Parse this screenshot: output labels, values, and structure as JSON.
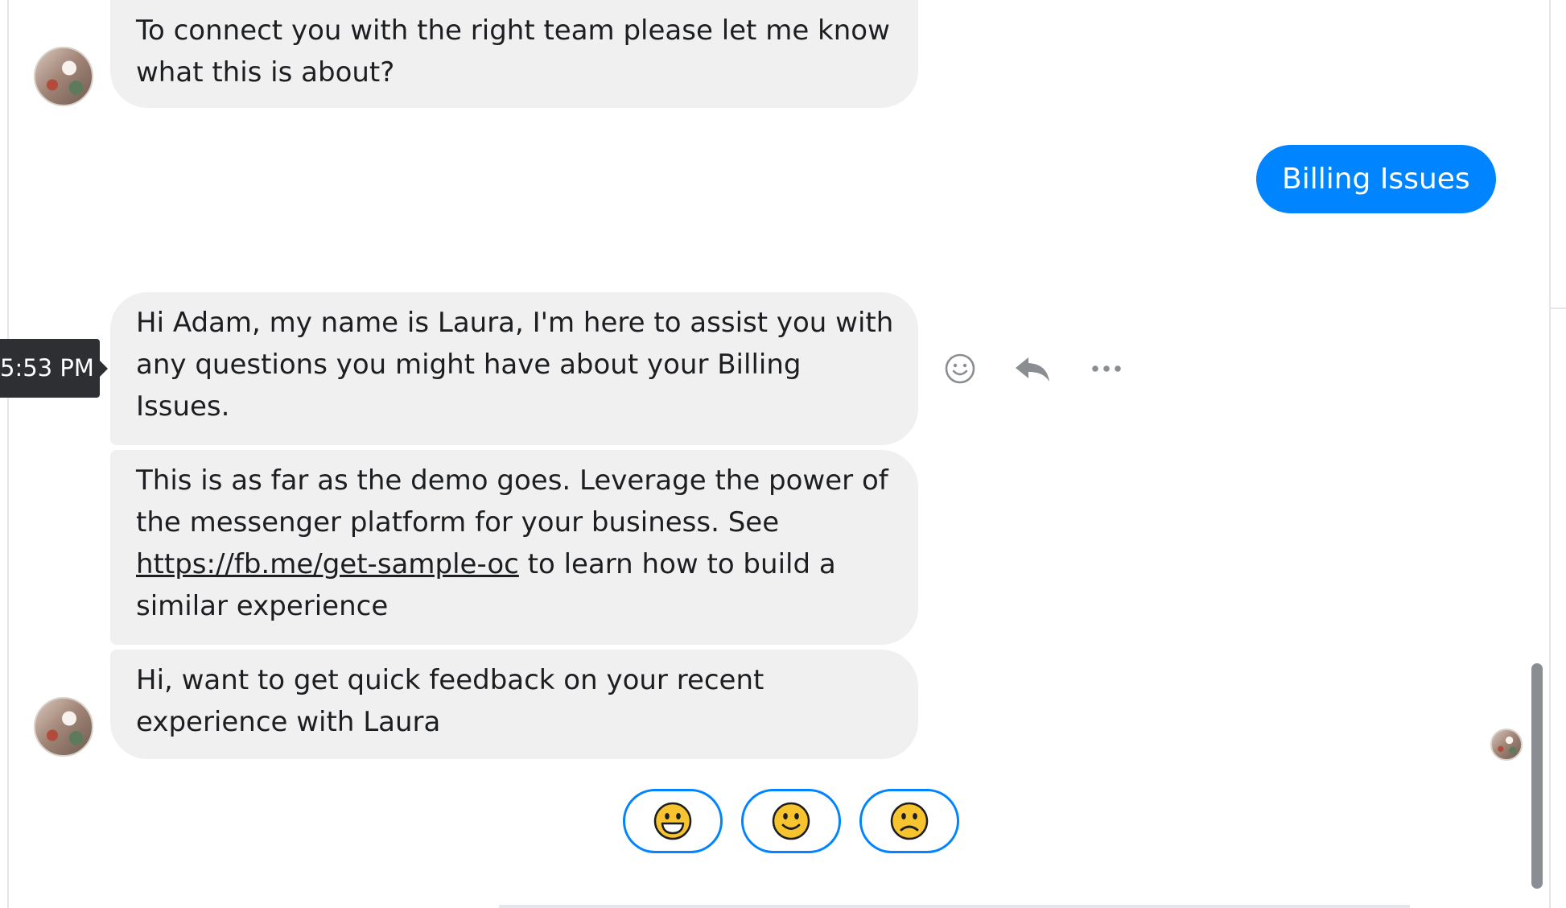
{
  "conversation": {
    "messages": [
      {
        "text": "To connect you with the right team please let me know what this is about?"
      },
      {
        "text": "Hi Adam, my name is Laura, I'm here to assist you with any questions you might have about your Billing Issues."
      },
      {
        "text_before": "This is as far as the demo goes. Leverage the power of the messenger platform for your business. See ",
        "link": "https://fb.me/get-sample-oc",
        "text_after": " to learn how to build a similar experience"
      },
      {
        "text": "Hi, want to get quick feedback on your recent experience with Laura"
      }
    ],
    "sent": {
      "text": "Billing Issues"
    },
    "timestamp_tooltip": "5:53 PM"
  },
  "actions": {
    "icons": [
      "emoji-icon",
      "reply-icon",
      "more-icon"
    ]
  },
  "quick_replies": {
    "icons": [
      "grinning-face-icon",
      "slightly-smiling-face-icon",
      "slightly-frowning-face-icon"
    ]
  },
  "colors": {
    "accent": "#0084ff",
    "bubble_gray": "#f0f0f0",
    "tooltip": "#2d2f33",
    "emoji_yellow": "#f7c32e"
  }
}
